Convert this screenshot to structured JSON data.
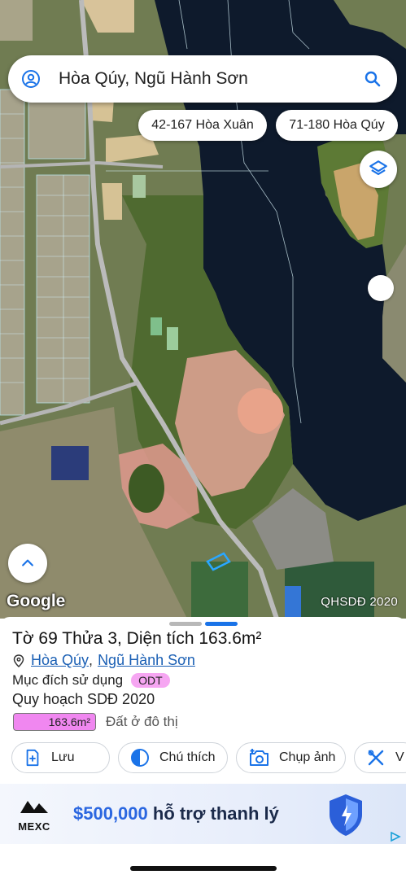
{
  "search": {
    "query": "Hòa Qúy, Ngũ Hành Sơn"
  },
  "chips": [
    "42-167 Hòa Xuân",
    "71-180 Hòa Qúy"
  ],
  "map": {
    "provider_logo": "Google",
    "layer_label": "QHSDĐ 2020"
  },
  "icons": {
    "user": "user-circle-icon",
    "search": "search-icon",
    "layers": "layers-icon",
    "up": "chevron-up-icon",
    "pin": "location-pin-icon"
  },
  "parcel": {
    "title": "Tờ 69 Thửa 3, Diện tích 163.6m²",
    "ward": "Hòa Qúy",
    "district": "Ngũ Hành Sơn",
    "purpose_label": "Mục đích sử dụng",
    "purpose_code": "ODT",
    "plan_label": "Quy hoạch SDĐ 2020",
    "plan_area": "163.6m²",
    "plan_use": "Đất ở đô thị"
  },
  "actions": [
    {
      "label": "Lưu",
      "icon": "add-bookmark-icon"
    },
    {
      "label": "Chú thích",
      "icon": "contrast-icon"
    },
    {
      "label": "Chụp ảnh",
      "icon": "camera-add-icon"
    },
    {
      "label": "V",
      "icon": "tools-icon"
    }
  ],
  "ad": {
    "brand": "MEXC",
    "amount": "$500,000",
    "text": " hỗ trợ thanh lý"
  },
  "colors": {
    "accent": "#1a73e8",
    "link": "#1a5fb4",
    "odt_badge": "#f6a6f2",
    "plan_fill": "#f087f0"
  }
}
